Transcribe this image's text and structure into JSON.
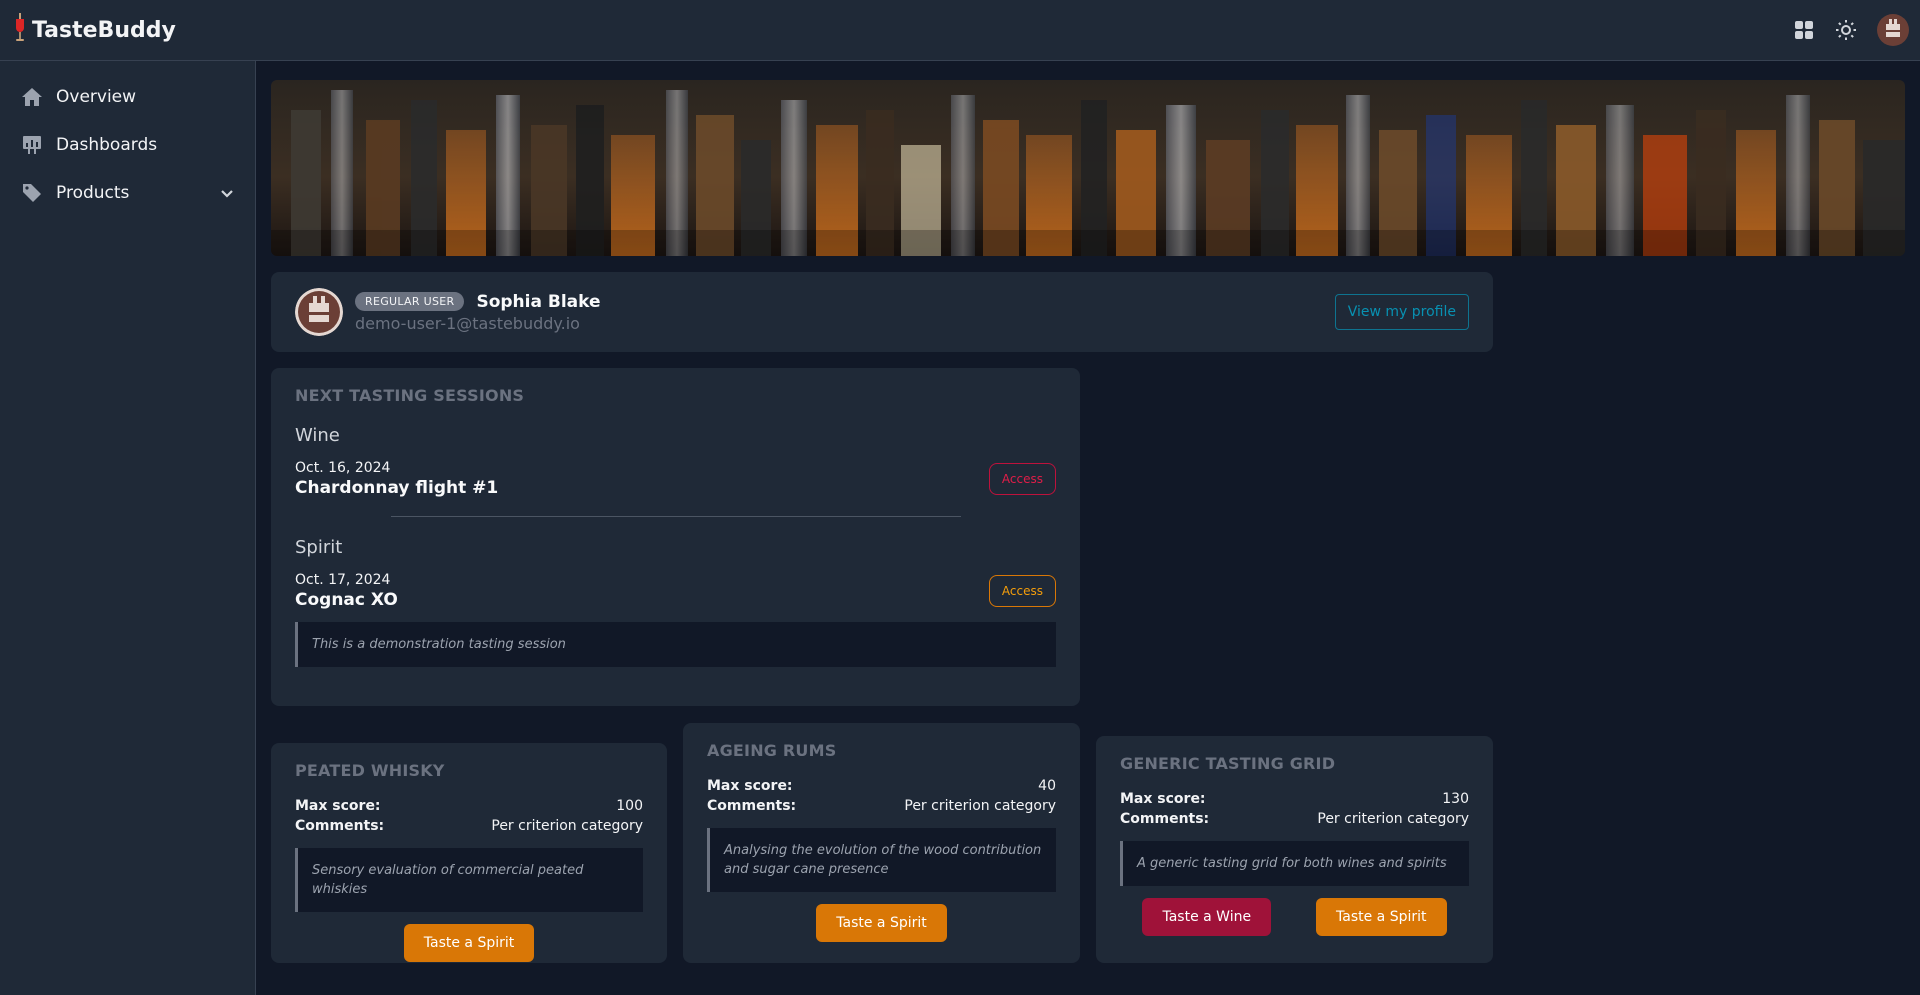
{
  "app": {
    "name": "TasteBuddy",
    "logo_icon": "wine-glass-icon"
  },
  "topbar": {
    "icons": [
      "apps-grid-icon",
      "sun-icon",
      "user-avatar"
    ]
  },
  "sidebar": {
    "items": [
      {
        "label": "Overview",
        "icon": "home-icon"
      },
      {
        "label": "Dashboards",
        "icon": "presentation-chart-icon"
      },
      {
        "label": "Products",
        "icon": "tag-icon",
        "expandable": true
      }
    ]
  },
  "profile": {
    "badge": "REGULAR USER",
    "name": "Sophia Blake",
    "email": "demo-user-1@tastebuddy.io",
    "view_profile_label": "View my profile"
  },
  "sessions": {
    "title": "NEXT TASTING SESSIONS",
    "groups": [
      {
        "category": "Wine",
        "date": "Oct. 16, 2024",
        "name": "Chardonnay flight #1",
        "action": "Access",
        "color": "#e11d48"
      },
      {
        "category": "Spirit",
        "date": "Oct. 17, 2024",
        "name": "Cognac XO",
        "action": "Access",
        "color": "#f59e0b",
        "note": "This is a demonstration tasting session"
      }
    ]
  },
  "grids": [
    {
      "title": "PEATED WHISKY",
      "max_score_label": "Max score:",
      "max_score": "100",
      "comments_label": "Comments:",
      "comments": "Per criterion category",
      "description": "Sensory evaluation of commercial peated whiskies",
      "buttons": [
        "Taste a Spirit"
      ]
    },
    {
      "title": "AGEING RUMS",
      "max_score_label": "Max score:",
      "max_score": "40",
      "comments_label": "Comments:",
      "comments": "Per criterion category",
      "description": "Analysing the evolution of the wood contribution and sugar cane presence",
      "buttons": [
        "Taste a Spirit"
      ]
    },
    {
      "title": "GENERIC TASTING GRID",
      "max_score_label": "Max score:",
      "max_score": "130",
      "comments_label": "Comments:",
      "comments": "Per criterion category",
      "description": "A generic tasting grid for both wines and spirits",
      "buttons": [
        "Taste a Wine",
        "Taste a Spirit"
      ]
    }
  ],
  "colors": {
    "background": "#111827",
    "surface": "#1f2937",
    "spirit_accent": "#d97706",
    "wine_accent": "#9f1239",
    "profile_accent": "#0891b2"
  }
}
